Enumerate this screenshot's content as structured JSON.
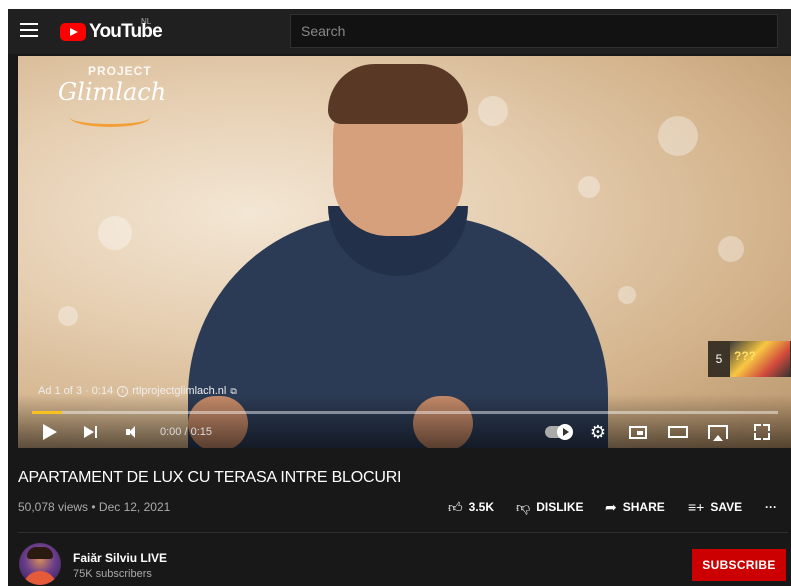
{
  "header": {
    "logo_text": "YouTube",
    "country_code": "NL",
    "search_placeholder": "Search"
  },
  "player": {
    "ad_info": "Ad 1 of 3 · 0:14",
    "ad_link": "rtlprojectglimlach.nl",
    "skip_countdown": "5",
    "skip_thumb_text": "???",
    "time": "0:00 / 0:15",
    "progress_fraction": 0.04,
    "overlay_small": "PROJECT",
    "overlay_big": "Glimlach",
    "progress_color": "#f9c31f"
  },
  "video": {
    "title": "APARTAMENT DE LUX CU TERASA INTRE BLOCURI",
    "meta": "50,078 views • Dec 12, 2021",
    "likes": "3.5K",
    "dislike_label": "DISLIKE",
    "share_label": "SHARE",
    "save_label": "SAVE",
    "more_label": "···"
  },
  "channel": {
    "name": "Faiăr Silviu LIVE",
    "subscribers": "75K subscribers",
    "subscribe_label": "SUBSCRIBE",
    "subscribe_color": "#cc0000"
  },
  "icons": {
    "like": "thumbs-up-icon",
    "dislike": "thumbs-down-icon",
    "share": "share-icon",
    "save": "playlist-add-icon",
    "info": "info-icon",
    "external": "external-link-icon"
  }
}
